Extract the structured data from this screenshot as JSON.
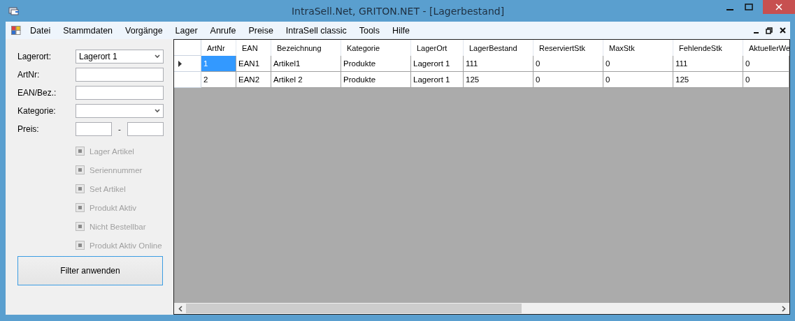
{
  "window": {
    "title": "IntraSell.Net, GRITON.NET - [Lagerbestand]"
  },
  "menu": [
    "Datei",
    "Stammdaten",
    "Vorgänge",
    "Lager",
    "Anrufe",
    "Preise",
    "IntraSell classic",
    "Tools",
    "Hilfe"
  ],
  "filters": {
    "fields": [
      {
        "kind": "dropdown",
        "label": "Lagerort:",
        "value": "Lagerort 1"
      },
      {
        "kind": "text",
        "label": "ArtNr:"
      },
      {
        "kind": "text",
        "label": "EAN/Bez.:"
      },
      {
        "kind": "dropdown",
        "label": "Kategorie:"
      },
      {
        "kind": "range",
        "label": "Preis:",
        "separator": "-"
      }
    ],
    "checkboxes": [
      {
        "label": "Lager Artikel",
        "indeterminate": true,
        "disabled": true
      },
      {
        "label": "Seriennummer",
        "indeterminate": true,
        "disabled": true
      },
      {
        "label": "Set Artikel",
        "indeterminate": true,
        "disabled": true
      },
      {
        "label": "Produkt Aktiv",
        "indeterminate": true,
        "disabled": true
      },
      {
        "label": "Nicht Bestellbar",
        "indeterminate": true,
        "disabled": true
      },
      {
        "label": "Produkt Aktiv Online",
        "indeterminate": true,
        "disabled": true
      }
    ],
    "apply_button": "Filter anwenden"
  },
  "table": {
    "columns": [
      "ArtNr",
      "EAN",
      "Bezeichnung",
      "Kategorie",
      "LagerOrt",
      "LagerBestand",
      "ReserviertStk",
      "MaxStk",
      "FehlendeStk",
      "AktuellerWe"
    ],
    "rows": [
      {
        "current": true,
        "cells": [
          {
            "text": "1",
            "selected": true
          },
          {
            "text": "EAN1",
            "selected": false
          },
          {
            "text": "Artikel1",
            "selected": false
          },
          {
            "text": "Produkte",
            "selected": false
          },
          {
            "text": "Lagerort 1",
            "selected": false
          },
          {
            "text": "111",
            "selected": false
          },
          {
            "text": "0",
            "selected": false
          },
          {
            "text": "0",
            "selected": false
          },
          {
            "text": "111",
            "selected": false
          },
          {
            "text": "0",
            "selected": false
          }
        ]
      },
      {
        "current": false,
        "cells": [
          {
            "text": "2",
            "selected": false
          },
          {
            "text": "EAN2",
            "selected": false
          },
          {
            "text": "Artikel 2",
            "selected": false
          },
          {
            "text": "Produkte",
            "selected": false
          },
          {
            "text": "Lagerort 1",
            "selected": false
          },
          {
            "text": "125",
            "selected": false
          },
          {
            "text": "0",
            "selected": false
          },
          {
            "text": "0",
            "selected": false
          },
          {
            "text": "125",
            "selected": false
          },
          {
            "text": "0",
            "selected": false
          }
        ]
      }
    ]
  }
}
